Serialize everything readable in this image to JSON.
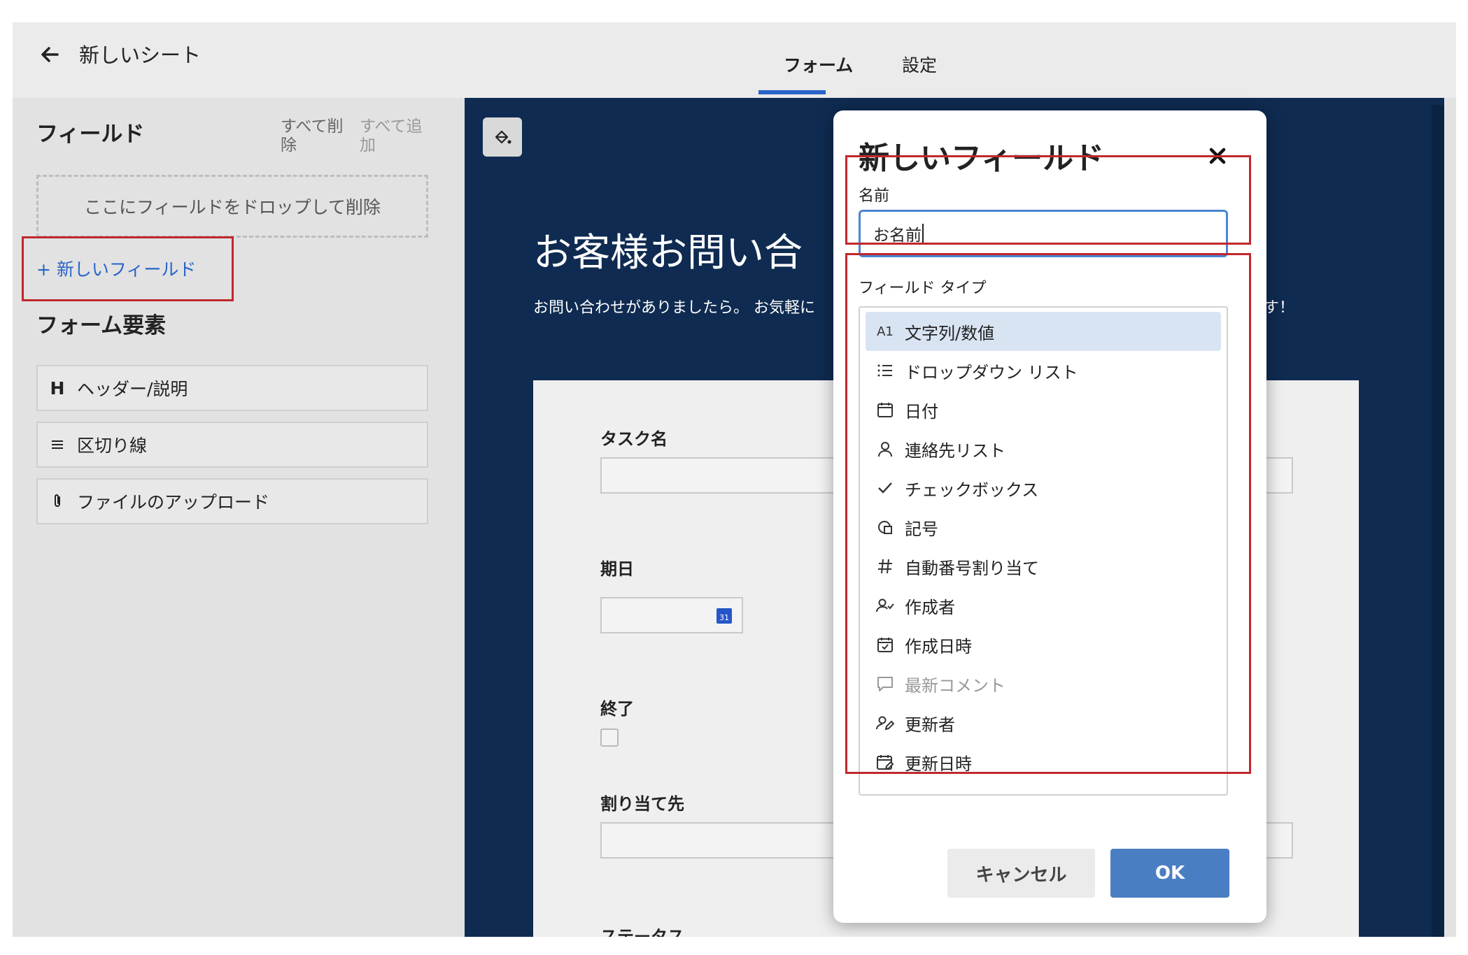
{
  "header": {
    "title": "新しいシート",
    "tabs": {
      "form": "フォーム",
      "settings": "設定"
    }
  },
  "sidebar": {
    "fields_heading": "フィールド",
    "delete_all": "すべて削除",
    "add_all": "すべて追加",
    "dropzone_text": "ここにフィールドをドロップして削除",
    "new_field_link": "+ 新しいフィールド",
    "form_elements_heading": "フォーム要素",
    "elements": [
      {
        "icon": "H",
        "label": "ヘッダー/説明"
      },
      {
        "icon": "divider-icon",
        "label": "区切り線"
      },
      {
        "icon": "paperclip-icon",
        "label": "ファイルのアップロード"
      }
    ]
  },
  "form": {
    "title": "お客様お問い合",
    "description": "お問い合わせがありましたら。 お気軽に",
    "description_end": "す！",
    "fields": {
      "task_name": "タスク名",
      "due_date": "期日",
      "done": "終了",
      "assignee": "割り当て先",
      "status": "ステータス"
    },
    "calendar_day": "31"
  },
  "dialog": {
    "title": "新しいフィールド",
    "name_label": "名前",
    "name_value": "お名前",
    "type_label": "フィールド タイプ",
    "types": [
      {
        "icon": "A1",
        "label": "文字列/数値",
        "selected": true,
        "disabled": false
      },
      {
        "icon": "list-icon",
        "label": "ドロップダウン リスト",
        "selected": false,
        "disabled": false
      },
      {
        "icon": "calendar-icon",
        "label": "日付",
        "selected": false,
        "disabled": false
      },
      {
        "icon": "person-icon",
        "label": "連絡先リスト",
        "selected": false,
        "disabled": false
      },
      {
        "icon": "checkmark-icon",
        "label": "チェックボックス",
        "selected": false,
        "disabled": false
      },
      {
        "icon": "symbol-icon",
        "label": "記号",
        "selected": false,
        "disabled": false
      },
      {
        "icon": "hash-icon",
        "label": "自動番号割り当て",
        "selected": false,
        "disabled": false
      },
      {
        "icon": "person-check-icon",
        "label": "作成者",
        "selected": false,
        "disabled": false
      },
      {
        "icon": "calendar-check-icon",
        "label": "作成日時",
        "selected": false,
        "disabled": false
      },
      {
        "icon": "comment-icon",
        "label": "最新コメント",
        "selected": false,
        "disabled": true
      },
      {
        "icon": "person-edit-icon",
        "label": "更新者",
        "selected": false,
        "disabled": false
      },
      {
        "icon": "calendar-edit-icon",
        "label": "更新日時",
        "selected": false,
        "disabled": false
      }
    ],
    "cancel_label": "キャンセル",
    "ok_label": "OK"
  },
  "colors": {
    "accent": "#2a64c8",
    "canvas": "#0f2b51",
    "ok_button": "#4a7ec2",
    "annotation": "#c0282d",
    "selected_row": "#d9e4f3"
  }
}
